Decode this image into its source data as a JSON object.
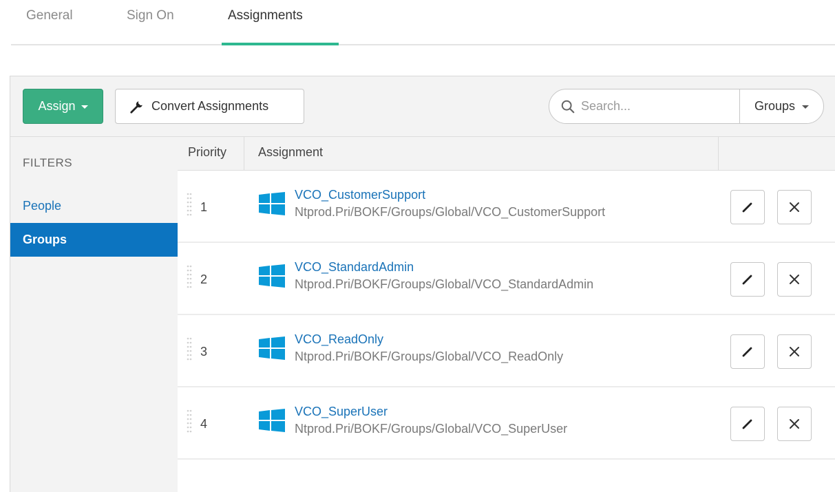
{
  "tabs": [
    {
      "label": "General"
    },
    {
      "label": "Sign On"
    },
    {
      "label": "Assignments",
      "active": true
    }
  ],
  "toolbar": {
    "assign_label": "Assign",
    "convert_label": "Convert Assignments",
    "search_placeholder": "Search...",
    "scope_label": "Groups"
  },
  "filters": {
    "heading": "FILTERS",
    "items": [
      {
        "label": "People"
      },
      {
        "label": "Groups",
        "selected": true
      }
    ]
  },
  "table": {
    "headers": {
      "priority": "Priority",
      "assignment": "Assignment"
    },
    "rows": [
      {
        "priority": "1",
        "name": "VCO_CustomerSupport",
        "path": "Ntprod.Pri/BOKF/Groups/Global/VCO_CustomerSupport"
      },
      {
        "priority": "2",
        "name": "VCO_StandardAdmin",
        "path": "Ntprod.Pri/BOKF/Groups/Global/VCO_StandardAdmin"
      },
      {
        "priority": "3",
        "name": "VCO_ReadOnly",
        "path": "Ntprod.Pri/BOKF/Groups/Global/VCO_ReadOnly"
      },
      {
        "priority": "4",
        "name": "VCO_SuperUser",
        "path": "Ntprod.Pri/BOKF/Groups/Global/VCO_SuperUser"
      }
    ]
  },
  "icons": {
    "row_icon": "windows-icon",
    "edit": "pencil-icon",
    "delete": "close-icon",
    "search": "search-icon",
    "convert": "wrench-icon"
  },
  "colors": {
    "accent_green": "#3aae82",
    "tab_underline": "#2eb890",
    "link_blue": "#1a73b8",
    "selected_blue": "#0c74c0",
    "windows_blue": "#0a9ad8"
  }
}
